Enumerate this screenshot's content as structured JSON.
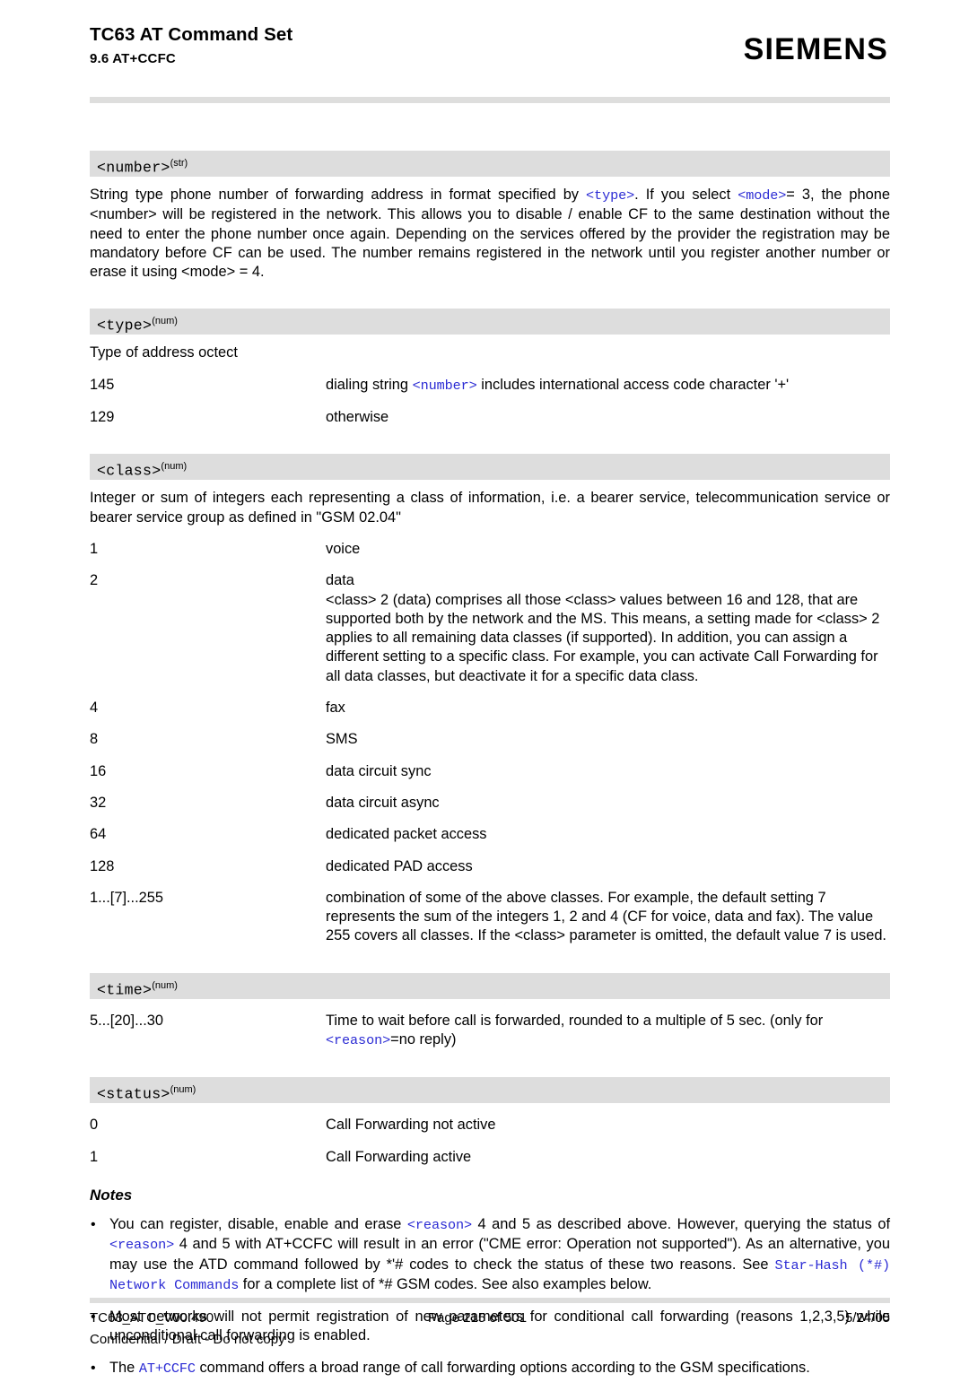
{
  "header": {
    "doc_title": "TC63 AT Command Set",
    "section_number_title": "9.6 AT+CCFC",
    "brand": "SIEMENS"
  },
  "sections": [
    {
      "id": "number",
      "param_name": "<number>",
      "param_sup": "(str)",
      "body_parts": [
        {
          "t": "String type phone number of forwarding address in format specified by ",
          "style": "plain"
        },
        {
          "t": "<type>",
          "style": "link"
        },
        {
          "t": ". If you select ",
          "style": "plain"
        },
        {
          "t": "<mode>",
          "style": "link"
        },
        {
          "t": "= 3, the phone <number> will be registered in the network. This allows you to disable / enable CF to the same destination without the need to enter the phone number once again. Depending on the services offered by the provider the registration may be mandatory before CF can be used. The number remains registered in the network until you register another number or erase it using <mode> = 4.",
          "style": "plain"
        }
      ]
    },
    {
      "id": "type",
      "param_name": "<type>",
      "param_sup": "(num)",
      "intro": "Type of address octect",
      "rows": [
        {
          "value": "145",
          "desc_parts": [
            {
              "t": "dialing string ",
              "style": "plain"
            },
            {
              "t": "<number>",
              "style": "link"
            },
            {
              "t": " includes international access code character '+'",
              "style": "plain"
            }
          ]
        },
        {
          "value": "129",
          "desc_parts": [
            {
              "t": "otherwise",
              "style": "plain"
            }
          ]
        }
      ]
    },
    {
      "id": "class",
      "param_name": "<class>",
      "param_sup": "(num)",
      "intro": "Integer or sum of integers each representing a class of information, i.e. a bearer service, telecommunication service or bearer service group as defined in \"GSM 02.04\"",
      "rows": [
        {
          "value": "1",
          "desc_parts": [
            {
              "t": "voice",
              "style": "plain"
            }
          ]
        },
        {
          "value": "2",
          "desc_parts": [
            {
              "t": "data",
              "style": "plain"
            }
          ],
          "desc_extra": "<class> 2 (data) comprises all those <class> values between 16 and 128, that are supported both by the network and the MS. This means, a setting made for <class> 2 applies to all remaining data classes (if supported). In addition, you can assign a different setting to a specific class. For example, you can activate Call Forwarding for all data classes, but deactivate it for a specific data class."
        },
        {
          "value": "4",
          "desc_parts": [
            {
              "t": "fax",
              "style": "plain"
            }
          ]
        },
        {
          "value": "8",
          "desc_parts": [
            {
              "t": "SMS",
              "style": "plain"
            }
          ]
        },
        {
          "value": "16",
          "desc_parts": [
            {
              "t": "data circuit sync",
              "style": "plain"
            }
          ]
        },
        {
          "value": "32",
          "desc_parts": [
            {
              "t": "data circuit async",
              "style": "plain"
            }
          ]
        },
        {
          "value": "64",
          "desc_parts": [
            {
              "t": "dedicated packet access",
              "style": "plain"
            }
          ]
        },
        {
          "value": "128",
          "desc_parts": [
            {
              "t": "dedicated PAD access",
              "style": "plain"
            }
          ]
        },
        {
          "value": "1...[7]...255",
          "desc_parts": [
            {
              "t": "combination of some of the above classes. For example, the default setting 7 represents the sum of the integers 1, 2 and 4 (CF for voice, data and fax). The value 255 covers all classes. If the <class> parameter is omitted, the default value 7 is used.",
              "style": "plain"
            }
          ]
        }
      ]
    },
    {
      "id": "time",
      "param_name": "<time>",
      "param_sup": "(num)",
      "rows": [
        {
          "value": "5...[20]...30",
          "desc_parts": [
            {
              "t": "Time to wait before call is forwarded, rounded to a multiple of 5 sec. (only for ",
              "style": "plain"
            },
            {
              "t": "<reason>",
              "style": "link"
            },
            {
              "t": "=no reply)",
              "style": "plain"
            }
          ]
        }
      ]
    },
    {
      "id": "status",
      "param_name": "<status>",
      "param_sup": "(num)",
      "rows": [
        {
          "value": "0",
          "desc_parts": [
            {
              "t": "Call Forwarding not active",
              "style": "plain"
            }
          ]
        },
        {
          "value": "1",
          "desc_parts": [
            {
              "t": "Call Forwarding active",
              "style": "plain"
            }
          ]
        }
      ]
    }
  ],
  "notes": {
    "title": "Notes",
    "bullet_char": "•",
    "items": [
      {
        "parts": [
          {
            "t": "You can register, disable, enable and erase ",
            "style": "plain"
          },
          {
            "t": "<reason>",
            "style": "link"
          },
          {
            "t": " 4 and 5 as described above. However, querying the status of ",
            "style": "plain"
          },
          {
            "t": "<reason>",
            "style": "link"
          },
          {
            "t": " 4 and 5 with AT+CCFC will result in an error (\"CME error: Operation not supported\"). As an alternative, you may use the ATD command followed by *'# codes to check the status of these two reasons. See ",
            "style": "plain"
          },
          {
            "t": "Star-Hash (*#) Network Commands",
            "style": "link"
          },
          {
            "t": " for a complete list of *# GSM codes. See also examples below.",
            "style": "plain"
          }
        ]
      },
      {
        "parts": [
          {
            "t": "Most networks will not permit registration of new parameters for conditional call forwarding (reasons 1,2,3,5) while unconditional call forwarding is enabled.",
            "style": "plain"
          }
        ]
      },
      {
        "parts": [
          {
            "t": "The ",
            "style": "plain"
          },
          {
            "t": "AT+CCFC",
            "style": "link"
          },
          {
            "t": " command offers a broad range of call forwarding options according to the GSM specifications.",
            "style": "plain"
          }
        ]
      }
    ]
  },
  "footer": {
    "doc_id": "TC63_ATC_V00.490",
    "page": "Page 215 of 501",
    "date": "5/24/05",
    "confidentiality": "Confidential / Draft - Do not copy"
  },
  "colors": {
    "link_blue": "#2b2bd4",
    "bar_gray": "#dddddd",
    "rule_gray": "#dededd"
  }
}
